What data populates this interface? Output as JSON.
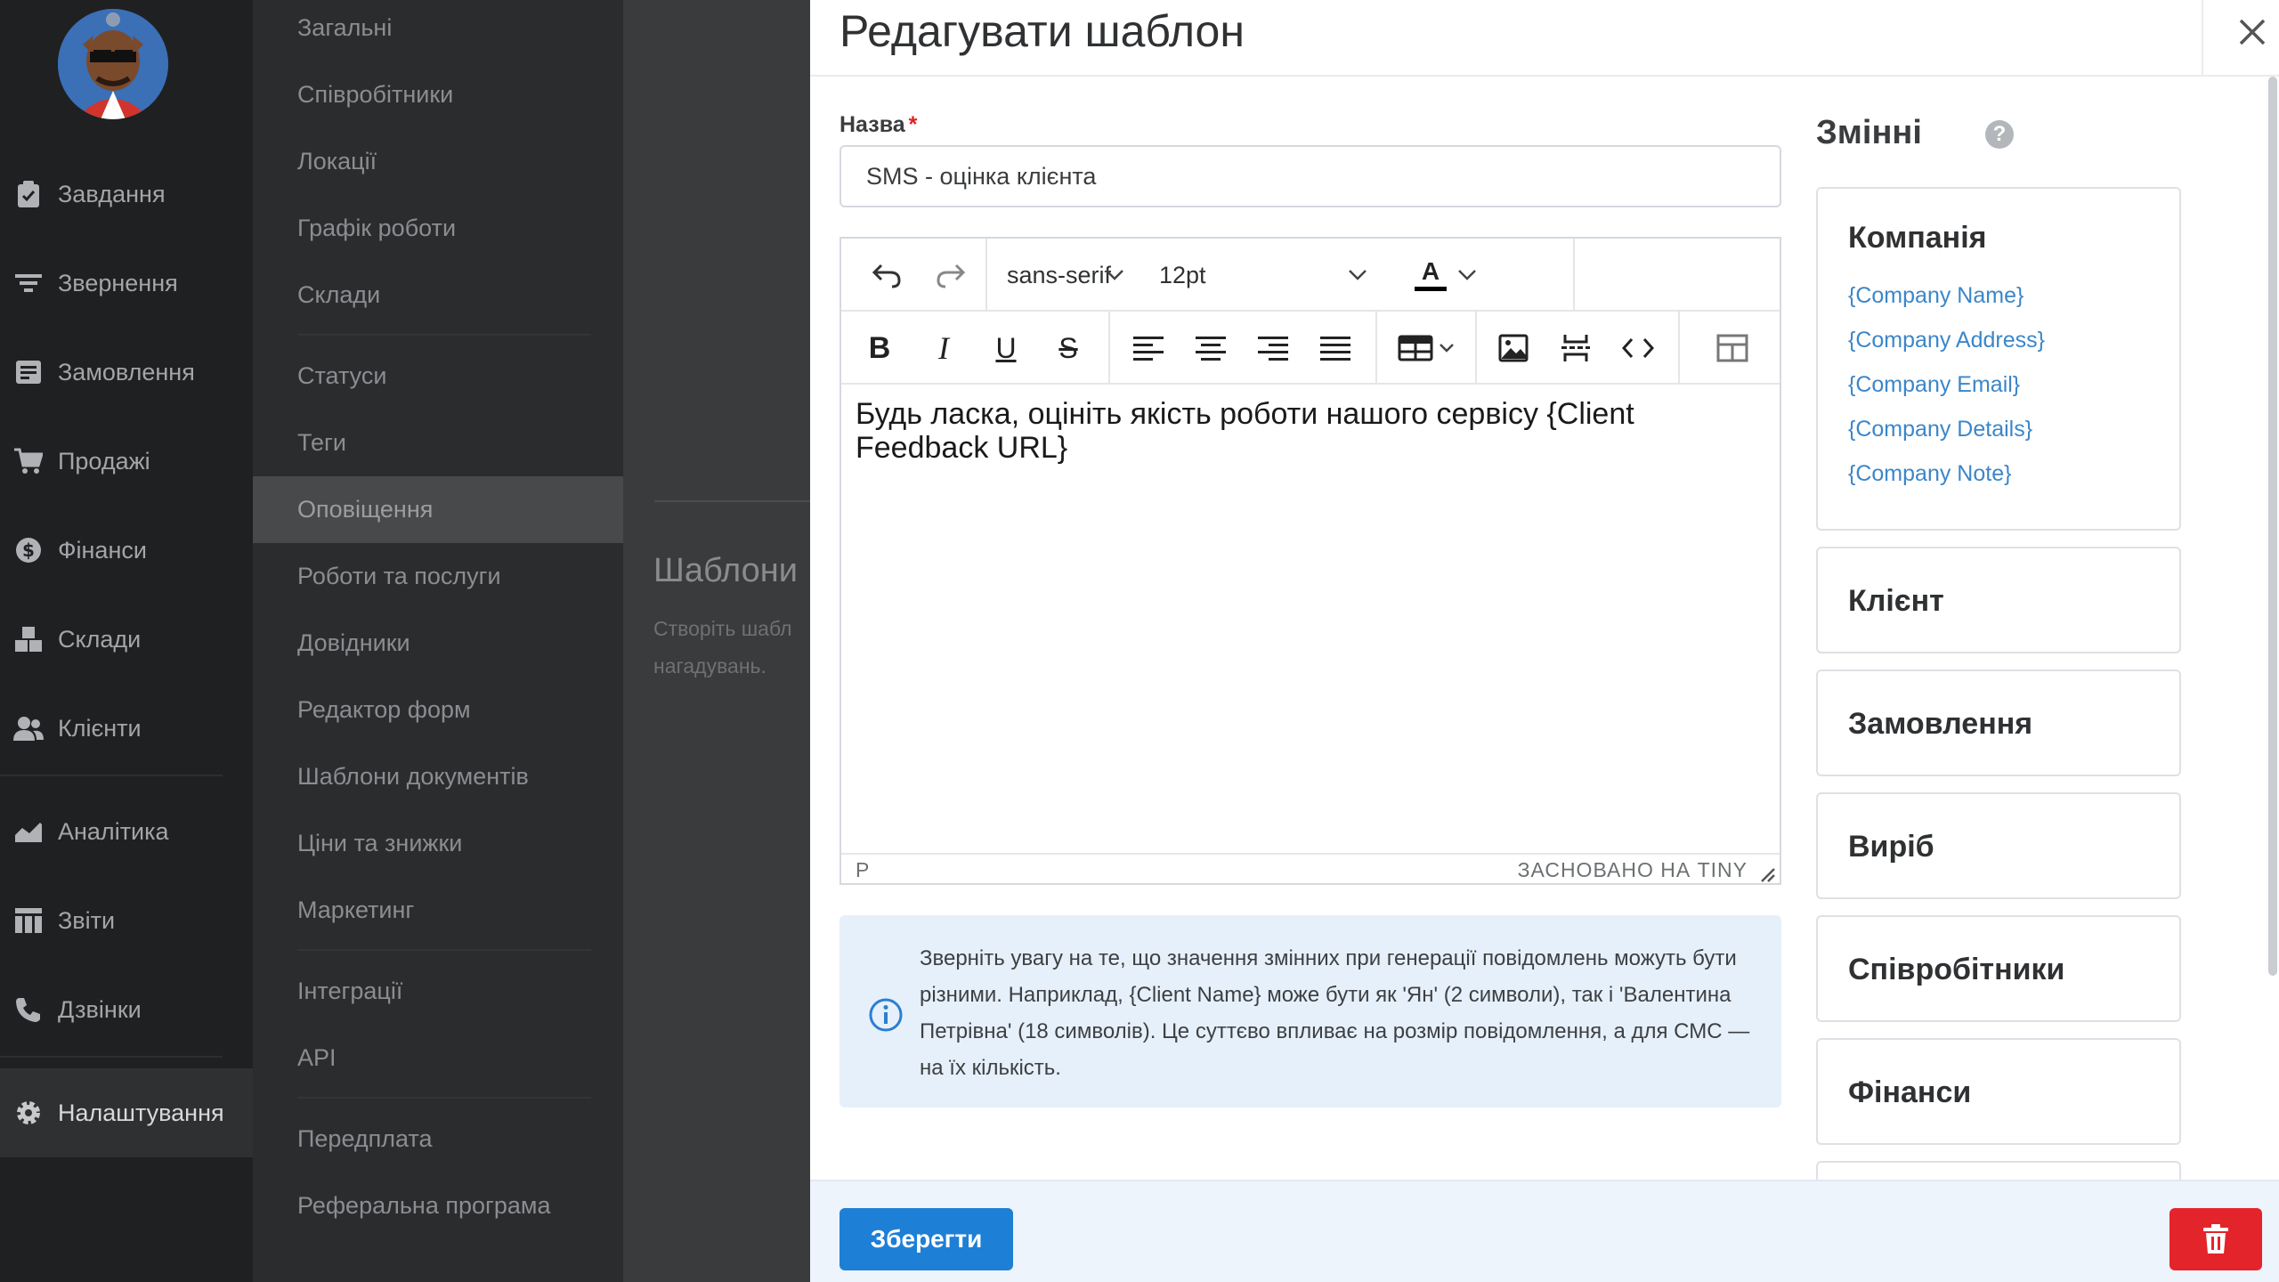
{
  "sidebar": {
    "items": [
      {
        "label": "Завдання",
        "icon": "clipboard-check-icon"
      },
      {
        "label": "Звернення",
        "icon": "filter-lines-icon"
      },
      {
        "label": "Замовлення",
        "icon": "order-card-icon"
      },
      {
        "label": "Продажі",
        "icon": "cart-icon"
      },
      {
        "label": "Фінанси",
        "icon": "dollar-coin-icon"
      },
      {
        "label": "Склади",
        "icon": "boxes-icon"
      },
      {
        "label": "Клієнти",
        "icon": "users-icon"
      },
      {
        "label": "Аналітика",
        "icon": "area-chart-icon"
      },
      {
        "label": "Звіти",
        "icon": "reports-grid-icon"
      },
      {
        "label": "Дзвінки",
        "icon": "phone-icon"
      },
      {
        "label": "Налаштування",
        "icon": "gear-icon"
      }
    ]
  },
  "settings_menu": {
    "items": [
      {
        "label": "Загальні"
      },
      {
        "label": "Співробітники"
      },
      {
        "label": "Локації"
      },
      {
        "label": "Графік роботи"
      },
      {
        "label": "Склади"
      },
      {
        "label": "Статуси"
      },
      {
        "label": "Теги"
      },
      {
        "label": "Оповіщення"
      },
      {
        "label": "Роботи та послуги"
      },
      {
        "label": "Довідники"
      },
      {
        "label": "Редактор форм"
      },
      {
        "label": "Шаблони документів"
      },
      {
        "label": "Ціни та знижки"
      },
      {
        "label": "Маркетинг"
      },
      {
        "label": "Інтеграції"
      },
      {
        "label": "API"
      },
      {
        "label": "Передплата"
      },
      {
        "label": "Реферальна програма"
      }
    ]
  },
  "background": {
    "title": "Шаблони",
    "desc_line1": "Створіть шабл",
    "desc_line2": "нагадувань."
  },
  "modal": {
    "title": "Редагувати шаблон",
    "name_label": "Назва",
    "required_mark": "*",
    "name_value": "SMS - оцінка клієнта",
    "editor": {
      "font_family": "sans-serif",
      "font_size": "12pt",
      "font_color_letter": "A",
      "body": "Будь ласка, оцініть якість роботи нашого сервісу {Client Feedback URL}",
      "status_path": "P",
      "status_brand": "ЗАСНОВАНО НА TINY"
    },
    "info_note": "Зверніть увагу на те, що значення змінних при генерації повідомлень можуть бути різними. Наприклад, {Client Name} може бути як 'Ян' (2 символи), так і 'Валентина Петрівна' (18 символів). Це суттєво впливає на розмір повідомлення, а для СМС — на їх кількість.",
    "variables": {
      "title": "Змінні",
      "help": "?",
      "company": {
        "title": "Компанія",
        "links": [
          "{Company Name}",
          "{Company Address}",
          "{Company Email}",
          "{Company Details}",
          "{Company Note}"
        ]
      },
      "groups": [
        "Клієнт",
        "Замовлення",
        "Виріб",
        "Співробітники",
        "Фінанси"
      ]
    },
    "save_label": "Зберегти"
  },
  "colors": {
    "primary": "#1e7fd6",
    "danger": "#e3242b",
    "link": "#3b86c9",
    "info_bg": "#e6f0fa"
  }
}
